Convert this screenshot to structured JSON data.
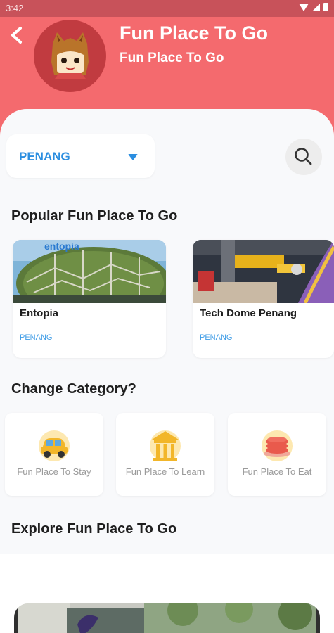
{
  "status_bar": {
    "time": "3:42"
  },
  "header": {
    "back_icon": "arrow-left-icon",
    "title": "Fun Place To Go",
    "subtitle": "Fun Place To Go"
  },
  "filter": {
    "state_value": "PENANG",
    "dropdown_icon": "caret-down-icon",
    "search_icon": "search-icon"
  },
  "sections": {
    "popular_title": "Popular Fun Place To Go",
    "category_title": "Change Category?",
    "explore_title": "Explore Fun Place To Go"
  },
  "popular_places": [
    {
      "name": "Entopia",
      "state": "PENANG"
    },
    {
      "name": "Tech Dome Penang",
      "state": "PENANG"
    }
  ],
  "categories": [
    {
      "label": "Fun Place To Stay",
      "icon": "car-icon"
    },
    {
      "label": "Fun Place To Learn",
      "icon": "museum-icon"
    },
    {
      "label": "Fun Place To Eat",
      "icon": "pancake-icon"
    }
  ],
  "colors": {
    "header_bg": "#f46a6e",
    "status_bg": "#c8525a",
    "accent_blue": "#2b8ee0",
    "content_bg": "#f8f9fb"
  }
}
